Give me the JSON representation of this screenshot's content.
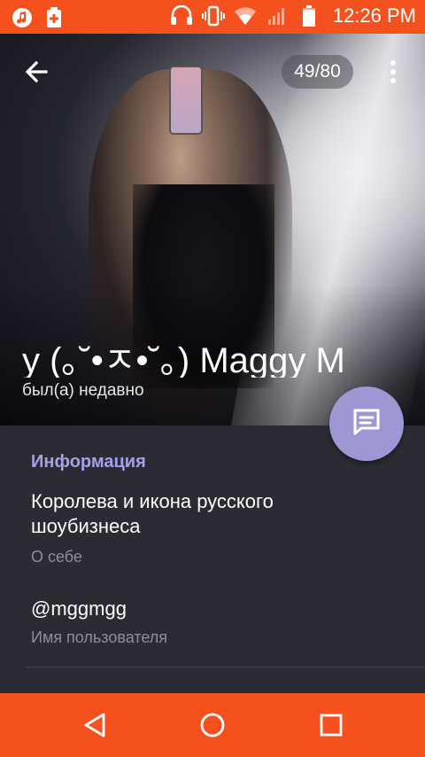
{
  "status_bar": {
    "time": "12:26 PM",
    "left_icons": [
      "music-icon",
      "battery-charging-icon"
    ],
    "right_icons": [
      "headset-icon",
      "vibrate-icon",
      "wifi-icon",
      "signal-icon",
      "battery-icon"
    ],
    "color": "#f4511e"
  },
  "header": {
    "photo_counter": "49/80",
    "name": "y (｡˘•ㅈ•˘｡) Maggy   M",
    "last_seen": "был(а) недавно"
  },
  "info": {
    "section_title": "Информация",
    "about_value": "Королева и икона русского шоубизнеса",
    "about_label": "О себе",
    "username_value": "@mggmgg",
    "username_label": "Имя пользователя"
  },
  "nav_bar": {
    "buttons": [
      "back-nav",
      "home-nav",
      "recents-nav"
    ]
  },
  "colors": {
    "accent": "#a6a0e6",
    "fab": "#9d98d4",
    "panel": "#2b2b33"
  }
}
